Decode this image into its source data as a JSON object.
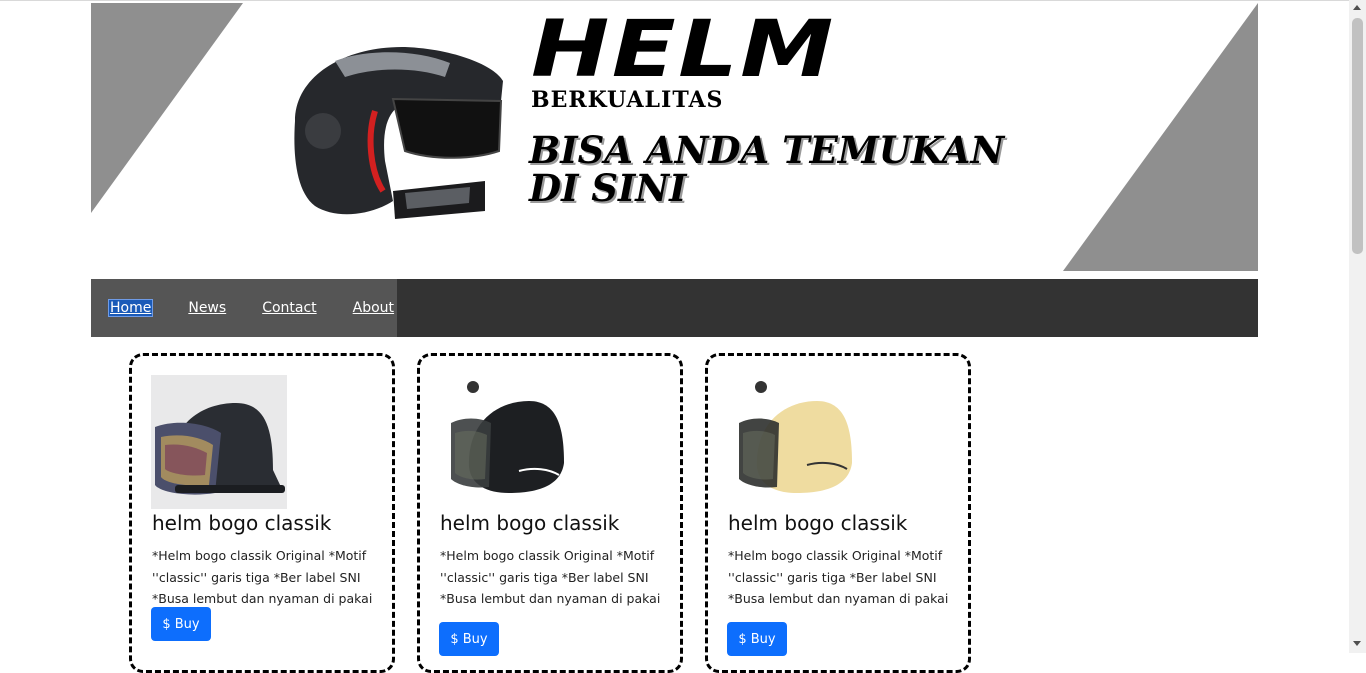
{
  "banner": {
    "title": "HELM",
    "subtitle": "BERKUALITAS",
    "tagline_line1": "BISA ANDA TEMUKAN",
    "tagline_line2": "DI SINI"
  },
  "nav": {
    "items": [
      {
        "label": "Home",
        "active": true
      },
      {
        "label": "News"
      },
      {
        "label": "Contact"
      },
      {
        "label": "About"
      }
    ]
  },
  "products": [
    {
      "title": "helm bogo classik",
      "description": "*Helm bogo classik Original *Motif ''classic'' garis tiga *Ber label SNI *Busa lembut dan nyaman di pakai",
      "button": "$ Buy",
      "shell_color": "#2a2d33"
    },
    {
      "title": "helm bogo classik",
      "description": "*Helm bogo classik Original *Motif ''classic'' garis tiga *Ber label SNI *Busa lembut dan nyaman di pakai",
      "button": "$ Buy",
      "shell_color": "#1d1f22"
    },
    {
      "title": "helm bogo classik",
      "description": "*Helm bogo classik Original *Motif ''classic'' garis tiga *Ber label SNI *Busa lembut dan nyaman di pakai",
      "button": "$ Buy",
      "shell_color": "#efdca0"
    }
  ],
  "colors": {
    "navbar": "#333333",
    "nav_group": "#555555",
    "button": "#0d6efd",
    "banner_triangle": "#8f8f8f"
  }
}
